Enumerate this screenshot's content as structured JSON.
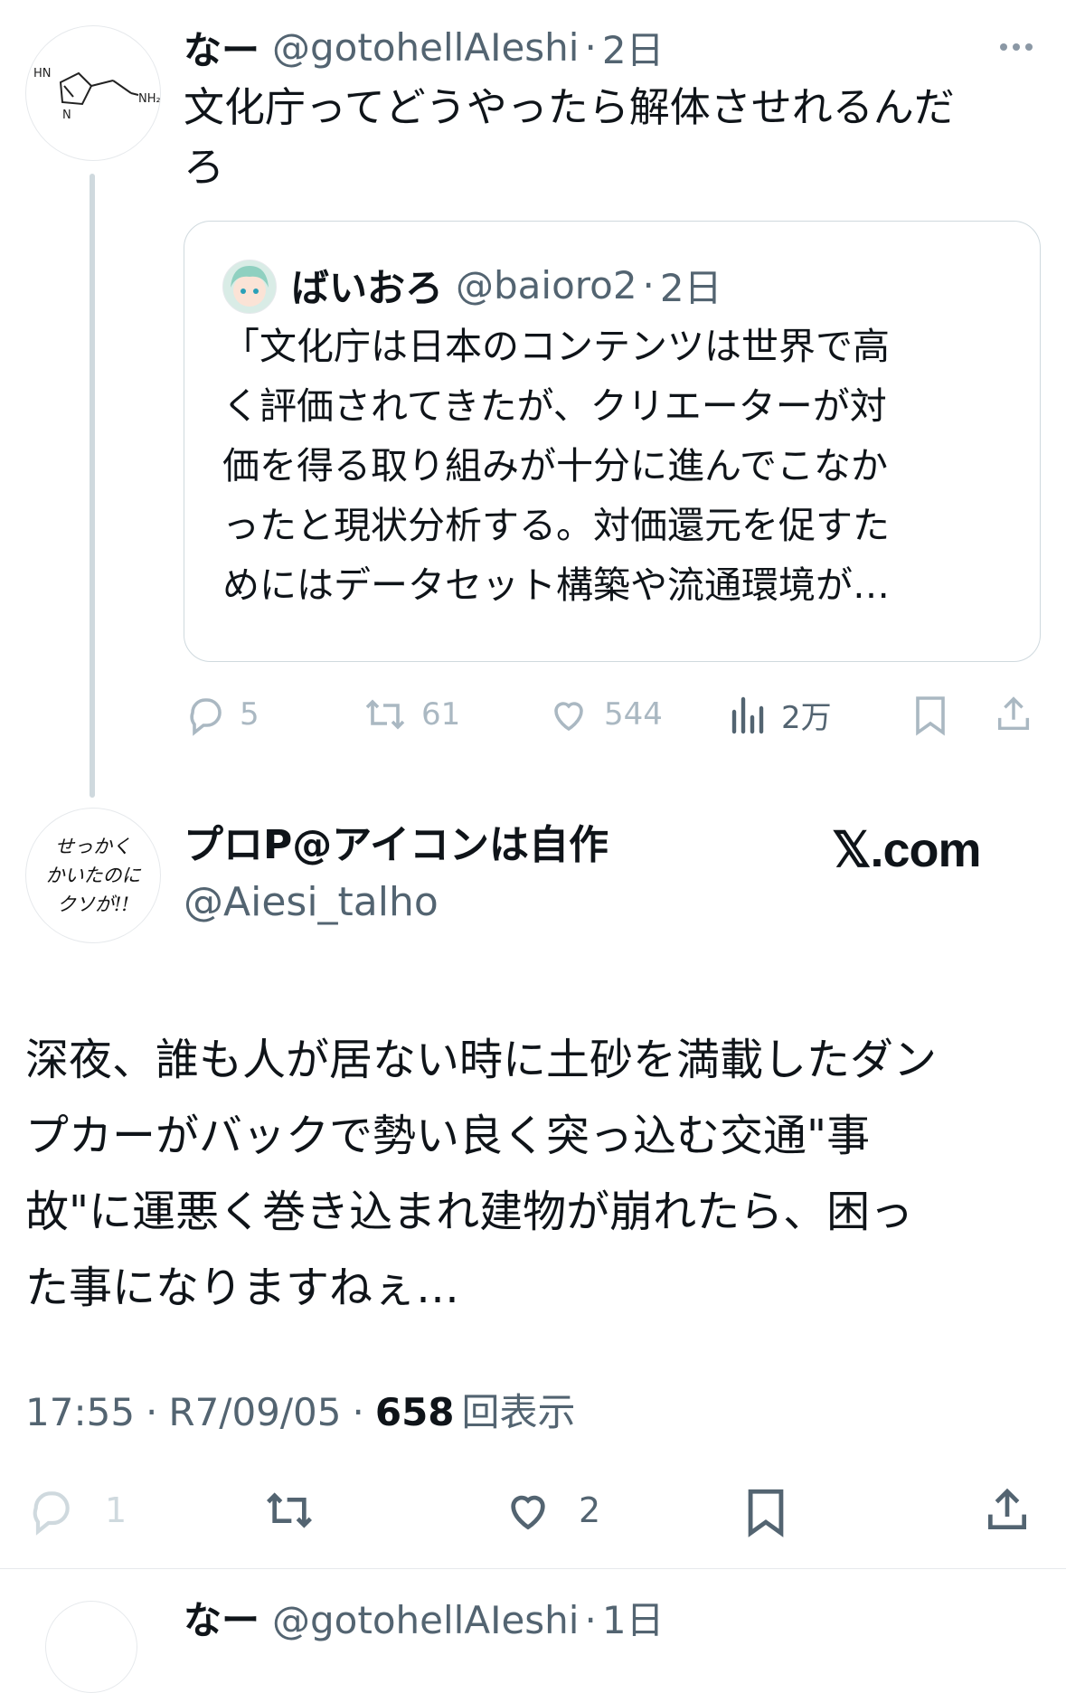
{
  "tweet1": {
    "display_name": "なー",
    "handle": "@gotohellAIeshi",
    "sep": "·",
    "time": "2日",
    "text_line1": "文化庁ってどうやったら解体させれるんだ",
    "text_line2": "ろ",
    "avatar_icon": "histamine-structure-icon",
    "actions": {
      "reply_count": "5",
      "retweet_count": "61",
      "like_count": "544",
      "views_count": "2万"
    }
  },
  "quote": {
    "display_name": "ばいおろ",
    "handle": "@baioro2",
    "sep": "·",
    "time": "2日",
    "lines": [
      "「文化庁は日本のコンテンツは世界で高",
      "く評価されてきたが、クリエーターが対",
      "価を得る取り組みが十分に進んでこなか",
      "ったと現状分析する。対価還元を促すた",
      "めにはデータセット構築や流通環境が…"
    ]
  },
  "tweet2": {
    "display_name": "プロP@アイコンは自作",
    "handle": "@Aiesi_talho",
    "brand": "𝕏.com",
    "avatar_text": [
      "せっかく",
      "かいたのに",
      "クソが!!"
    ],
    "text_lines": [
      "深夜、誰も人が居ない時に土砂を満載したダン",
      "プカーがバックで勢い良く突っ込む交通\"事",
      "故\"に運悪く巻き込まれ建物が崩れたら、困っ",
      "た事になりますねぇ…"
    ],
    "timestamp": "17:55",
    "date": "R7/09/05",
    "views": "658",
    "views_label": "回表示",
    "sep": "·",
    "actions": {
      "reply_count": "1",
      "like_count": "2"
    }
  },
  "tweet3_partial": {
    "display_name": "なー",
    "handle": "@gotohellAIeshi",
    "sep": "·",
    "time": "1日"
  },
  "colors": {
    "text": "#0f1419",
    "muted": "#536471",
    "light_action": "#aab8c2",
    "border": "#cfd9de"
  }
}
